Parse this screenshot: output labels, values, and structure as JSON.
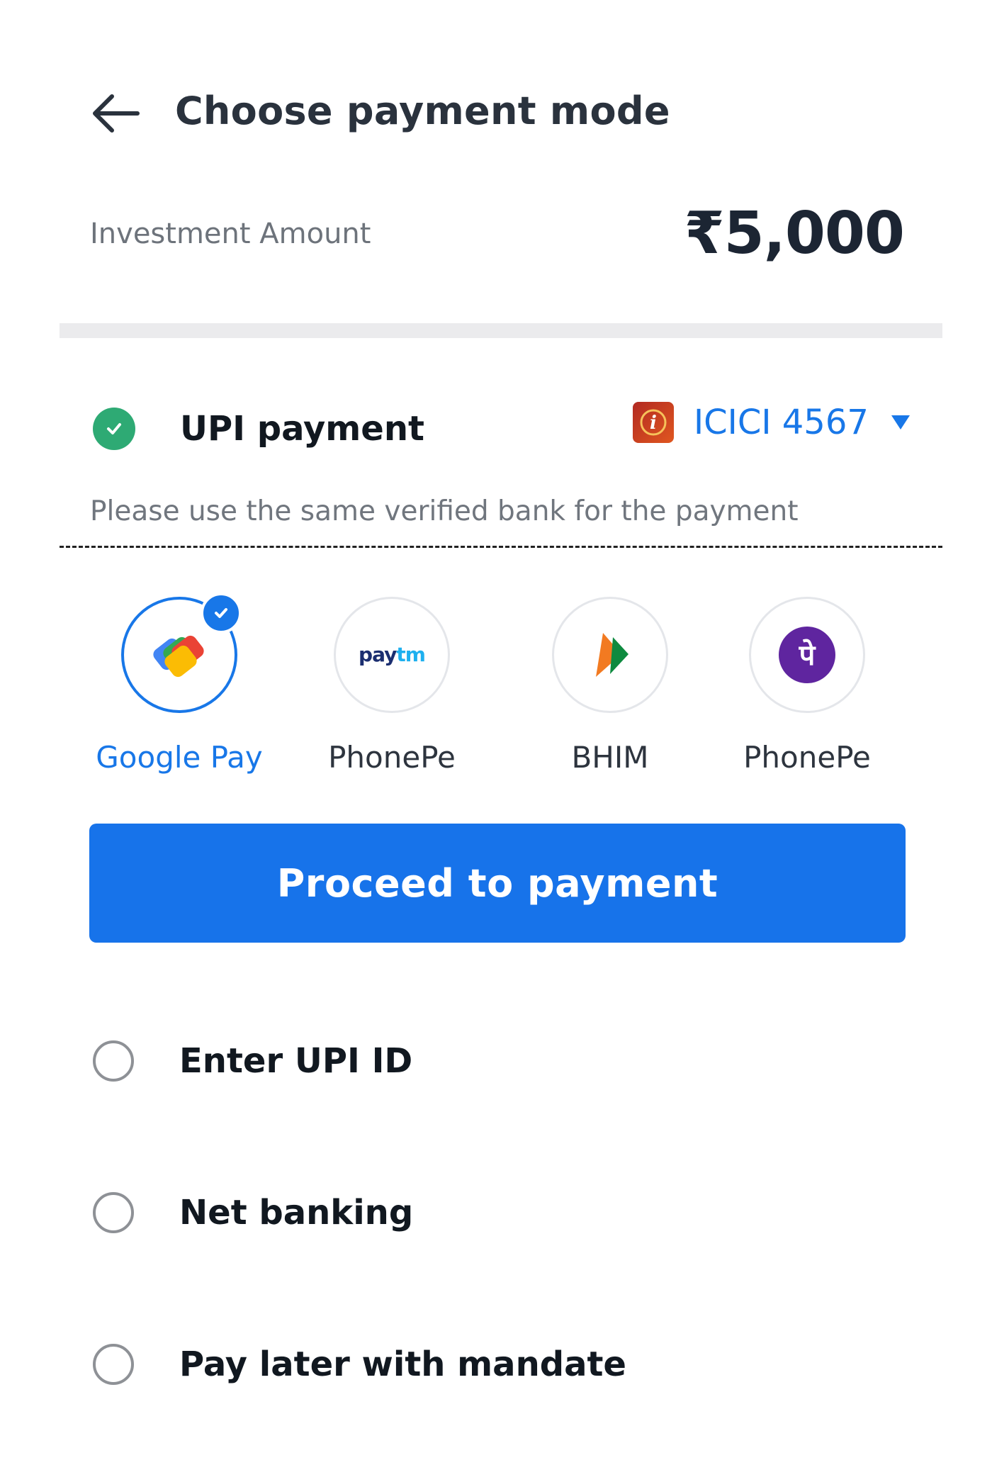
{
  "header": {
    "title": "Choose payment mode",
    "back_icon": "arrow-left-icon"
  },
  "investment": {
    "label": "Investment Amount",
    "amount": "₹5,000"
  },
  "upi": {
    "label": "UPI payment",
    "selected": true,
    "bank": {
      "name": "ICICI 4567",
      "logo_icon": "icici-bank-logo-icon"
    },
    "helper": "Please use the same verified bank for the payment"
  },
  "apps": [
    {
      "label": "Google Pay",
      "icon": "google-pay-icon",
      "selected": true
    },
    {
      "label": "PhonePe",
      "icon": "paytm-logo-icon",
      "logo_text": "paytm",
      "selected": false
    },
    {
      "label": "BHIM",
      "icon": "bhim-icon",
      "selected": false
    },
    {
      "label": "PhonePe",
      "icon": "phonepe-icon",
      "logo_text": "पे",
      "selected": false
    }
  ],
  "proceed": {
    "label": "Proceed to payment"
  },
  "options": [
    {
      "label": "Enter UPI ID",
      "selected": false
    },
    {
      "label": "Net banking",
      "selected": false
    },
    {
      "label": "Pay later with mandate",
      "selected": false
    }
  ],
  "colors": {
    "accent": "#1877e8",
    "success": "#2eaa74",
    "text": "#111820",
    "muted": "#6d737b"
  }
}
